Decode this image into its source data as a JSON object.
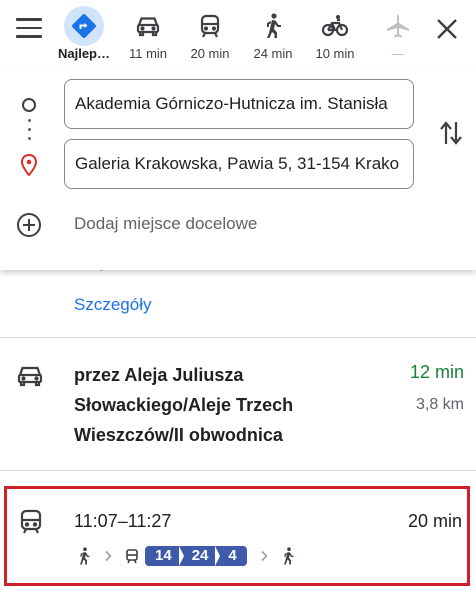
{
  "modes": [
    {
      "icon": "best-route-icon",
      "label": "Najlep…",
      "active": true
    },
    {
      "icon": "car-icon",
      "label": "11 min"
    },
    {
      "icon": "train-icon",
      "label": "20 min"
    },
    {
      "icon": "walk-icon",
      "label": "24 min"
    },
    {
      "icon": "bike-icon",
      "label": "10 min"
    },
    {
      "icon": "plane-icon",
      "label": "—",
      "disabled": true
    }
  ],
  "route": {
    "origin": "Akademia Górniczo-Hutnicza im. Stanisła",
    "destination": "Galeria Krakowska, Pawia 5, 31-154 Krako",
    "add_stop": "Dodaj miejsce docelowe"
  },
  "results": {
    "partial_text": "drogowe",
    "details_link": "Szczegóły",
    "car": {
      "route_name": "przez Aleja Juliusza Słowackiego/Aleje Trzech Wieszczów/II obwodnica",
      "duration": "12 min",
      "distance": "3,8 km"
    },
    "transit": {
      "times": "11:07–11:27",
      "duration": "20 min",
      "lines": [
        "14",
        "24",
        "4"
      ]
    }
  },
  "colors": {
    "accent": "#1a73e8",
    "active_mode_bg": "#d2e3fc",
    "best_route": "#1a73e8",
    "fast_time": "#188038",
    "line_badge": "#3f5aa9",
    "highlight_border": "#d0202a"
  }
}
